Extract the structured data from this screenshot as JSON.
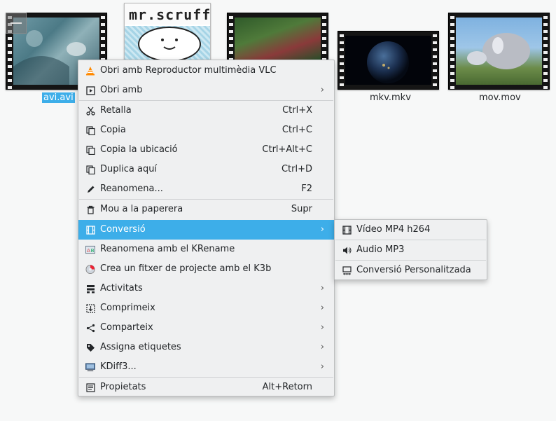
{
  "files": [
    {
      "name": "avi.avi",
      "selected": true
    },
    {
      "name": "",
      "kind": "image",
      "logo_text": "mr.scruff"
    },
    {
      "name": "",
      "kind": "video"
    },
    {
      "name": "mkv.mkv"
    },
    {
      "name": "mov.mov"
    }
  ],
  "context_menu": {
    "items": [
      {
        "label": "Obri amb Reproductor multimèdia VLC",
        "shortcut": "",
        "icon": "vlc-icon",
        "submenu": false
      },
      {
        "label": "Obri amb",
        "shortcut": "",
        "icon": "open-with-icon",
        "submenu": true
      },
      {
        "label": "Retalla",
        "shortcut": "Ctrl+X",
        "icon": "scissors-icon",
        "submenu": false
      },
      {
        "label": "Copia",
        "shortcut": "Ctrl+C",
        "icon": "copy-icon",
        "submenu": false
      },
      {
        "label": "Copia la ubicació",
        "shortcut": "Ctrl+Alt+C",
        "icon": "copy-location-icon",
        "submenu": false
      },
      {
        "label": "Duplica aquí",
        "shortcut": "Ctrl+D",
        "icon": "duplicate-icon",
        "submenu": false
      },
      {
        "label": "Reanomena...",
        "shortcut": "F2",
        "icon": "pencil-icon",
        "submenu": false
      },
      {
        "label": "Mou a la paperera",
        "shortcut": "Supr",
        "icon": "trash-icon",
        "submenu": false
      },
      {
        "label": "Conversió",
        "shortcut": "",
        "icon": "film-icon",
        "submenu": true,
        "highlighted": true
      },
      {
        "label": "Reanomena amb el KRename",
        "shortcut": "",
        "icon": "krename-icon",
        "submenu": false
      },
      {
        "label": "Crea un fitxer de projecte amb el K3b",
        "shortcut": "",
        "icon": "k3b-icon",
        "submenu": false
      },
      {
        "label": "Activitats",
        "shortcut": "",
        "icon": "activities-icon",
        "submenu": true
      },
      {
        "label": "Comprimeix",
        "shortcut": "",
        "icon": "compress-icon",
        "submenu": true
      },
      {
        "label": "Comparteix",
        "shortcut": "",
        "icon": "share-icon",
        "submenu": true
      },
      {
        "label": "Assigna etiquetes",
        "shortcut": "",
        "icon": "tag-icon",
        "submenu": true
      },
      {
        "label": "KDiff3...",
        "shortcut": "",
        "icon": "kdiff3-icon",
        "submenu": true
      },
      {
        "label": "Propietats",
        "shortcut": "Alt+Retorn",
        "icon": "properties-icon",
        "submenu": false
      }
    ]
  },
  "submenu": {
    "items": [
      {
        "label": "Vídeo MP4 h264",
        "icon": "film-icon"
      },
      {
        "label": "Audio MP3",
        "icon": "speaker-icon"
      },
      {
        "label": "Conversió Personalitzada",
        "icon": "custom-convert-icon"
      }
    ]
  },
  "colors": {
    "highlight": "#3daee9",
    "menu_bg": "#eff0f1",
    "background": "#f7f8f8"
  }
}
